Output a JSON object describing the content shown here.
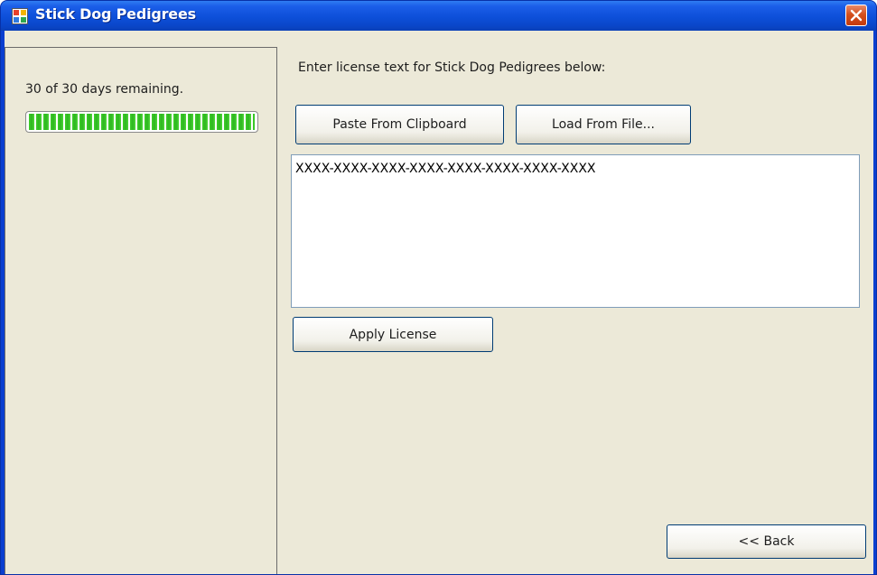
{
  "window": {
    "title": "Stick Dog Pedigrees",
    "app_icon": "app-window-icon",
    "close_icon": "close-icon"
  },
  "trial": {
    "days_text": "30 of 30 days remaining.",
    "progress_fraction": 1.0,
    "progress_color": "#3fcf2b"
  },
  "license": {
    "instruction": "Enter license text for Stick Dog Pedigrees below:",
    "paste_label": "Paste From Clipboard",
    "load_label": "Load From File...",
    "text_value": "XXXX-XXXX-XXXX-XXXX-XXXX-XXXX-XXXX-XXXX",
    "apply_label": "Apply License"
  },
  "navigation": {
    "back_label": "<< Back"
  },
  "colors": {
    "titlebar": "#0d4fd9",
    "client_bg": "#ece9d8",
    "close_button": "#d4501d"
  }
}
